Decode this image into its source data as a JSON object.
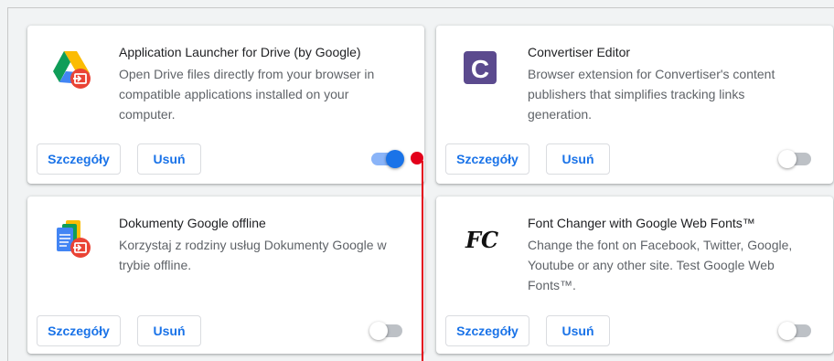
{
  "extensions": [
    {
      "name": "Application Launcher for Drive (by Google)",
      "description": "Open Drive files directly from your browser in compatible applications installed on your computer.",
      "details_label": "Szczegóły",
      "remove_label": "Usuń",
      "enabled": true,
      "icon": "google-drive-launcher-icon"
    },
    {
      "name": "Convertiser Editor",
      "description": "Browser extension for Convertiser's content publishers that simplifies tracking links generation.",
      "details_label": "Szczegóły",
      "remove_label": "Usuń",
      "enabled": false,
      "icon": "convertiser-icon",
      "icon_letter": "C"
    },
    {
      "name": "Dokumenty Google offline",
      "description": "Korzystaj z rodziny usług Dokumenty Google w trybie offline.",
      "details_label": "Szczegóły",
      "remove_label": "Usuń",
      "enabled": false,
      "icon": "google-docs-offline-icon"
    },
    {
      "name": "Font Changer with Google Web Fonts™",
      "description": "Change the font on Facebook, Twitter, Google, Youtube or any other site. Test Google Web Fonts™.",
      "details_label": "Szczegóły",
      "remove_label": "Usuń",
      "enabled": false,
      "icon": "font-changer-icon",
      "icon_letter": "FC"
    }
  ],
  "colors": {
    "accent": "#1a73e8",
    "toggle_on_track": "#8ab4f8",
    "annotation": "#e3001b"
  }
}
